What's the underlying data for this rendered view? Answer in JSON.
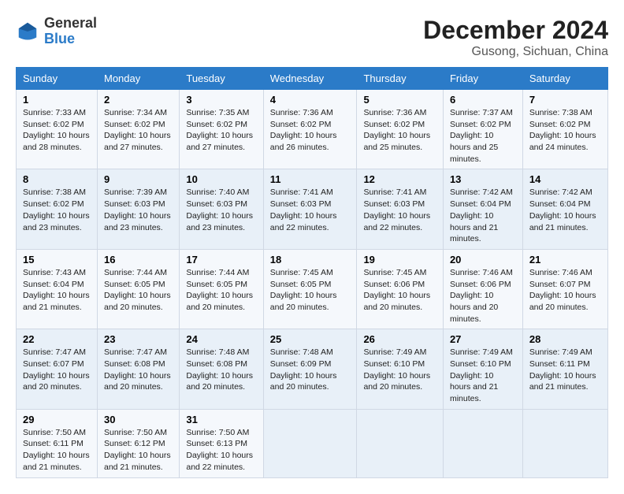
{
  "header": {
    "logo": {
      "line1": "General",
      "line2": "Blue"
    },
    "title": "December 2024",
    "subtitle": "Gusong, Sichuan, China"
  },
  "weekdays": [
    "Sunday",
    "Monday",
    "Tuesday",
    "Wednesday",
    "Thursday",
    "Friday",
    "Saturday"
  ],
  "weeks": [
    [
      {
        "day": "1",
        "sunrise": "7:33 AM",
        "sunset": "6:02 PM",
        "daylight": "10 hours and 28 minutes."
      },
      {
        "day": "2",
        "sunrise": "7:34 AM",
        "sunset": "6:02 PM",
        "daylight": "10 hours and 27 minutes."
      },
      {
        "day": "3",
        "sunrise": "7:35 AM",
        "sunset": "6:02 PM",
        "daylight": "10 hours and 27 minutes."
      },
      {
        "day": "4",
        "sunrise": "7:36 AM",
        "sunset": "6:02 PM",
        "daylight": "10 hours and 26 minutes."
      },
      {
        "day": "5",
        "sunrise": "7:36 AM",
        "sunset": "6:02 PM",
        "daylight": "10 hours and 25 minutes."
      },
      {
        "day": "6",
        "sunrise": "7:37 AM",
        "sunset": "6:02 PM",
        "daylight": "10 hours and 25 minutes."
      },
      {
        "day": "7",
        "sunrise": "7:38 AM",
        "sunset": "6:02 PM",
        "daylight": "10 hours and 24 minutes."
      }
    ],
    [
      {
        "day": "8",
        "sunrise": "7:38 AM",
        "sunset": "6:02 PM",
        "daylight": "10 hours and 23 minutes."
      },
      {
        "day": "9",
        "sunrise": "7:39 AM",
        "sunset": "6:03 PM",
        "daylight": "10 hours and 23 minutes."
      },
      {
        "day": "10",
        "sunrise": "7:40 AM",
        "sunset": "6:03 PM",
        "daylight": "10 hours and 23 minutes."
      },
      {
        "day": "11",
        "sunrise": "7:41 AM",
        "sunset": "6:03 PM",
        "daylight": "10 hours and 22 minutes."
      },
      {
        "day": "12",
        "sunrise": "7:41 AM",
        "sunset": "6:03 PM",
        "daylight": "10 hours and 22 minutes."
      },
      {
        "day": "13",
        "sunrise": "7:42 AM",
        "sunset": "6:04 PM",
        "daylight": "10 hours and 21 minutes."
      },
      {
        "day": "14",
        "sunrise": "7:42 AM",
        "sunset": "6:04 PM",
        "daylight": "10 hours and 21 minutes."
      }
    ],
    [
      {
        "day": "15",
        "sunrise": "7:43 AM",
        "sunset": "6:04 PM",
        "daylight": "10 hours and 21 minutes."
      },
      {
        "day": "16",
        "sunrise": "7:44 AM",
        "sunset": "6:05 PM",
        "daylight": "10 hours and 20 minutes."
      },
      {
        "day": "17",
        "sunrise": "7:44 AM",
        "sunset": "6:05 PM",
        "daylight": "10 hours and 20 minutes."
      },
      {
        "day": "18",
        "sunrise": "7:45 AM",
        "sunset": "6:05 PM",
        "daylight": "10 hours and 20 minutes."
      },
      {
        "day": "19",
        "sunrise": "7:45 AM",
        "sunset": "6:06 PM",
        "daylight": "10 hours and 20 minutes."
      },
      {
        "day": "20",
        "sunrise": "7:46 AM",
        "sunset": "6:06 PM",
        "daylight": "10 hours and 20 minutes."
      },
      {
        "day": "21",
        "sunrise": "7:46 AM",
        "sunset": "6:07 PM",
        "daylight": "10 hours and 20 minutes."
      }
    ],
    [
      {
        "day": "22",
        "sunrise": "7:47 AM",
        "sunset": "6:07 PM",
        "daylight": "10 hours and 20 minutes."
      },
      {
        "day": "23",
        "sunrise": "7:47 AM",
        "sunset": "6:08 PM",
        "daylight": "10 hours and 20 minutes."
      },
      {
        "day": "24",
        "sunrise": "7:48 AM",
        "sunset": "6:08 PM",
        "daylight": "10 hours and 20 minutes."
      },
      {
        "day": "25",
        "sunrise": "7:48 AM",
        "sunset": "6:09 PM",
        "daylight": "10 hours and 20 minutes."
      },
      {
        "day": "26",
        "sunrise": "7:49 AM",
        "sunset": "6:10 PM",
        "daylight": "10 hours and 20 minutes."
      },
      {
        "day": "27",
        "sunrise": "7:49 AM",
        "sunset": "6:10 PM",
        "daylight": "10 hours and 21 minutes."
      },
      {
        "day": "28",
        "sunrise": "7:49 AM",
        "sunset": "6:11 PM",
        "daylight": "10 hours and 21 minutes."
      }
    ],
    [
      {
        "day": "29",
        "sunrise": "7:50 AM",
        "sunset": "6:11 PM",
        "daylight": "10 hours and 21 minutes."
      },
      {
        "day": "30",
        "sunrise": "7:50 AM",
        "sunset": "6:12 PM",
        "daylight": "10 hours and 21 minutes."
      },
      {
        "day": "31",
        "sunrise": "7:50 AM",
        "sunset": "6:13 PM",
        "daylight": "10 hours and 22 minutes."
      },
      null,
      null,
      null,
      null
    ]
  ]
}
